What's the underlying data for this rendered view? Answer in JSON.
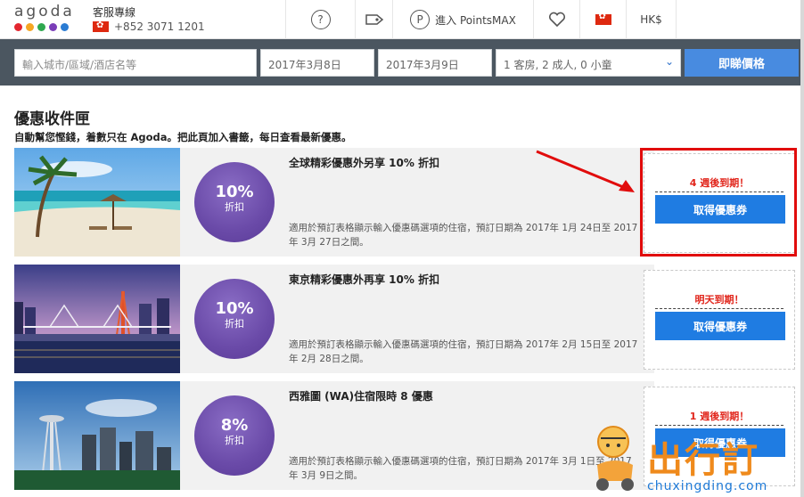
{
  "header": {
    "logo_text": "agoda",
    "logo_colors": [
      "#e3262f",
      "#f5a623",
      "#2fa84f",
      "#7a3db8",
      "#2b7cd3"
    ],
    "cs_label": "客服專線",
    "cs_phone": "+852 3071 1201",
    "help_icon": "question-circle-icon",
    "tag_icon": "tag-icon",
    "points_label": "進入 PointsMAX",
    "heart_icon": "heart-icon",
    "currency": "HK$"
  },
  "search": {
    "destination_placeholder": "輸入城市/區域/酒店名等",
    "checkin": "2017年3月8日",
    "checkout": "2017年3月9日",
    "guests": "1 客房, 2 成人, 0 小童",
    "button": "即睇價格"
  },
  "page": {
    "title": "優惠收件匣",
    "subtitle": "自動幫您慳錢，着數只在 Agoda。把此頁加入書籤，每日查看最新優惠。"
  },
  "deals": [
    {
      "photo": "tropical-beach",
      "pct": "10%",
      "pct_sub": "折扣",
      "headline": "全球精彩優惠外另享 10% 折扣",
      "description": "適用於預訂表格顯示輸入優惠碼選項的住宿，預訂日期為 2017年 1月 24日至 2017年 3月 27日之間。",
      "expiry": "4 週後到期！",
      "button": "取得優惠券"
    },
    {
      "photo": "tokyo-night-bridge",
      "pct": "10%",
      "pct_sub": "折扣",
      "headline": "東京精彩優惠外再享 10% 折扣",
      "description": "適用於預訂表格顯示輸入優惠碼選項的住宿，預訂日期為 2017年 2月 15日至 2017年 2月 28日之間。",
      "expiry": "明天到期！",
      "button": "取得優惠券"
    },
    {
      "photo": "seattle-skyline",
      "pct": "8%",
      "pct_sub": "折扣",
      "headline": "西雅圖 (WA)住宿限時 8 優惠",
      "description": "適用於預訂表格顯示輸入優惠碼選項的住宿，預訂日期為 2017年 3月 1日至 2017年 3月 9日之間。",
      "expiry": "1 週後到期！",
      "button": "取得優惠券"
    }
  ],
  "watermark": {
    "text": "出行訂",
    "url": "chuxingding.com"
  }
}
